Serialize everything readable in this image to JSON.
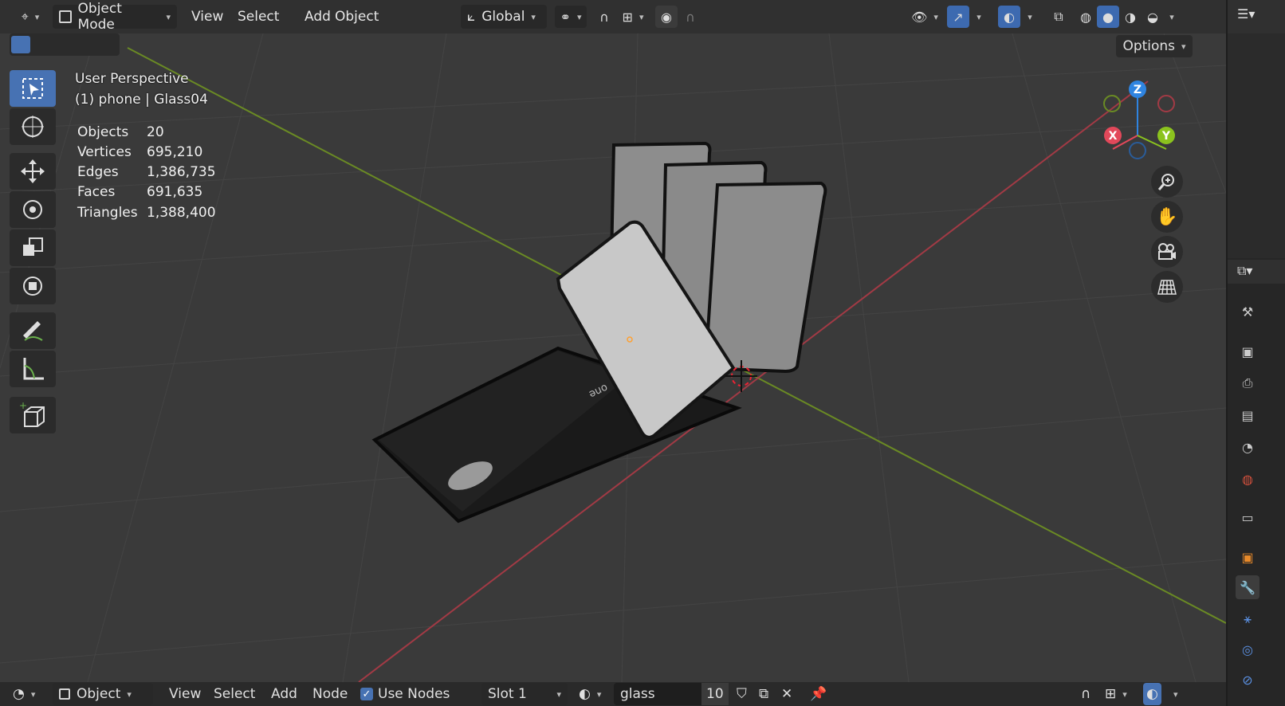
{
  "header": {
    "mode_label": "Object Mode",
    "menus": [
      "View",
      "Select",
      "Add",
      "Object"
    ],
    "transform_orientation": "Global",
    "options_label": "Options"
  },
  "viewport": {
    "view_name": "User Perspective",
    "active_object": "(1) phone | Glass04",
    "stats": [
      {
        "label": "Objects",
        "value": "20"
      },
      {
        "label": "Vertices",
        "value": "695,210"
      },
      {
        "label": "Edges",
        "value": "1,386,735"
      },
      {
        "label": "Faces",
        "value": "691,635"
      },
      {
        "label": "Triangles",
        "value": "1,388,400"
      }
    ],
    "gizmo": {
      "z": "Z",
      "x": "X",
      "y": "Y"
    },
    "phone_text": "one"
  },
  "bottom_bar": {
    "mode_label": "Object",
    "menus": [
      "View",
      "Select",
      "Add",
      "Node"
    ],
    "use_nodes_label": "Use Nodes",
    "slot_label": "Slot 1",
    "material_name": "glass",
    "user_count": "10"
  },
  "colors": {
    "accent": "#4772b3",
    "x_axis": "#e2485a",
    "y_axis": "#8bc31e",
    "z_axis": "#2f84e0",
    "viewport_bg": "#3a3a3a"
  },
  "icons": [
    "select-box-icon",
    "cursor-icon",
    "move-icon",
    "rotate-icon",
    "scale-icon",
    "transform-icon",
    "annotate-icon",
    "measure-icon",
    "add-cube-icon",
    "zoom-icon",
    "hand-icon",
    "camera-icon",
    "grid-icon"
  ]
}
